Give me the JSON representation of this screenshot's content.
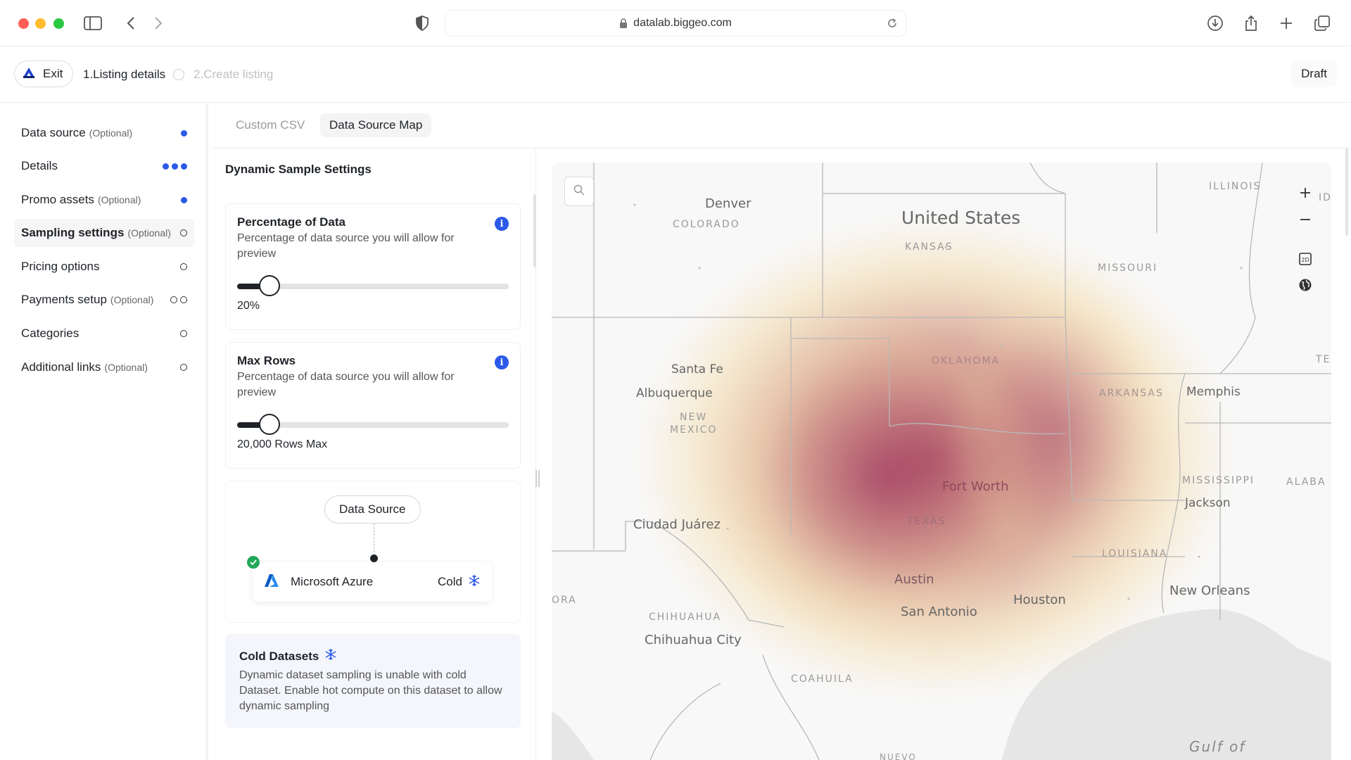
{
  "browser": {
    "url": "datalab.biggeo.com",
    "icons": [
      "sidebar-icon",
      "back-icon",
      "forward-icon",
      "shield-icon",
      "lock-icon",
      "reload-icon",
      "download-icon",
      "share-icon",
      "new-tab-icon",
      "tabs-overview-icon"
    ]
  },
  "header": {
    "exit_label": "Exit",
    "step1_label": "1.Listing details",
    "step2_label": "2.Create listing",
    "status_label": "Draft"
  },
  "sidebar": {
    "items": [
      {
        "label": "Data source",
        "optional": "(Optional)",
        "status": "filled-1"
      },
      {
        "label": "Details",
        "optional": "",
        "status": "filled-3"
      },
      {
        "label": "Promo assets",
        "optional": "(Optional)",
        "status": "filled-1"
      },
      {
        "label": "Sampling settings",
        "optional": "(Optional)",
        "status": "open-1"
      },
      {
        "label": "Pricing options",
        "optional": "",
        "status": "open-1"
      },
      {
        "label": "Payments setup",
        "optional": "(Optional)",
        "status": "open-2"
      },
      {
        "label": "Categories",
        "optional": "",
        "status": "open-1"
      },
      {
        "label": "Additional links",
        "optional": "(Optional)",
        "status": "open-1"
      }
    ],
    "active_index": 3
  },
  "tabs": [
    {
      "label": "Custom CSV",
      "selected": false
    },
    {
      "label": "Data Source Map",
      "selected": true
    }
  ],
  "panel": {
    "title": "Dynamic Sample Settings",
    "percentage": {
      "title": "Percentage of Data",
      "description": "Percentage of data source you will allow for preview",
      "value_label": "20%",
      "slider_fraction": 0.12
    },
    "max_rows": {
      "title": "Max Rows",
      "description": "Percentage of data source you will allow for preview",
      "value_label": "20,000 Rows Max",
      "slider_fraction": 0.12
    },
    "data_source": {
      "button_label": "Data Source",
      "provider": "Microsoft Azure",
      "temperature": "Cold"
    },
    "cold_datasets": {
      "title": "Cold Datasets",
      "description": "Dynamic dataset sampling is unable with cold Dataset. Enable hot compute on this dataset to allow dynamic sampling"
    }
  },
  "map": {
    "labels": {
      "denver": "Denver",
      "colorado": "COLORADO",
      "united_states": "United States",
      "kansas": "KANSAS",
      "illinois": "ILLINOIS",
      "id": "ID",
      "missouri": "MISSOURI",
      "oklahoma": "OKLAHOMA",
      "santa_fe": "Santa Fe",
      "albuquerque": "Albuquerque",
      "new": "NEW",
      "mexico": "MEXICO",
      "arkansas": "ARKANSAS",
      "memphis": "Memphis",
      "ten": "TEN",
      "fort_worth": "Fort Worth",
      "texas": "TEXAS",
      "mississippi": "MISSISSIPPI",
      "alaba": "ALABA",
      "jackson": "Jackson",
      "ciudad_juarez": "Ciudad Juárez",
      "louisiana": "LOUISIANA",
      "austin": "Austin",
      "houston": "Houston",
      "new_orleans": "New Orleans",
      "ora": "ORA",
      "san_antonio": "San Antonio",
      "chihuahua": "CHIHUAHUA",
      "chihuahua_city": "Chihuahua City",
      "coahuila": "COAHUILA",
      "nuevo": "NUEVO",
      "gulf_of": "Gulf of"
    },
    "controls": [
      "zoom-in-icon",
      "zoom-out-icon",
      "2d-view-icon",
      "globe-icon"
    ],
    "heat_colors": [
      "#9b2d55",
      "#c9837a",
      "#f3d8a0"
    ]
  }
}
